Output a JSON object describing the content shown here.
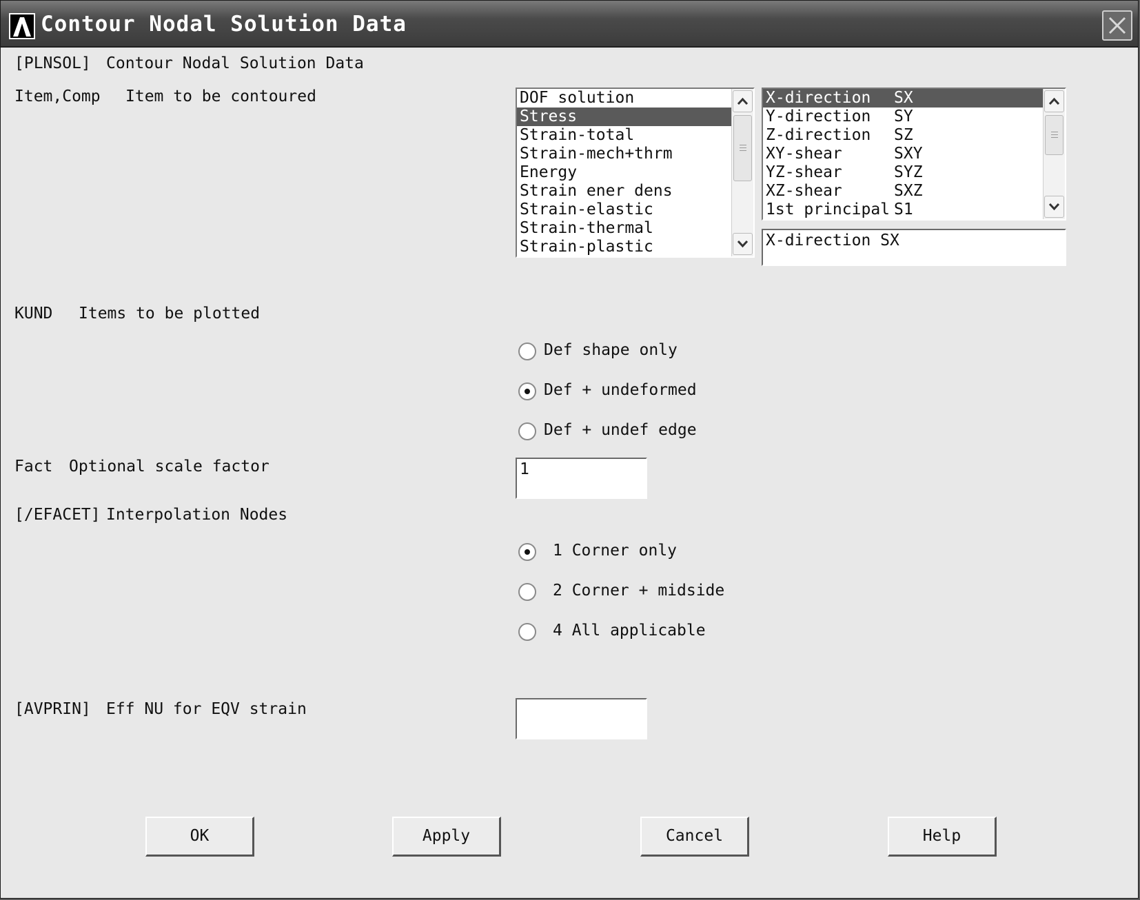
{
  "window": {
    "title": "Contour Nodal Solution Data"
  },
  "header": {
    "cmd": "[PLNSOL]",
    "desc": "Contour Nodal Solution Data"
  },
  "item_comp": {
    "code": "Item,Comp",
    "desc": "Item to be contoured",
    "items": [
      "DOF solution",
      "Stress",
      "Strain-total",
      "Strain-mech+thrm",
      "Energy",
      "Strain ener dens",
      "Strain-elastic",
      "Strain-thermal",
      "Strain-plastic"
    ],
    "selected_item": "Stress",
    "components": [
      {
        "name": "X-direction",
        "code": "SX"
      },
      {
        "name": "Y-direction",
        "code": "SY"
      },
      {
        "name": "Z-direction",
        "code": "SZ"
      },
      {
        "name": "XY-shear",
        "code": "SXY"
      },
      {
        "name": "YZ-shear",
        "code": "SYZ"
      },
      {
        "name": "XZ-shear",
        "code": "SXZ"
      },
      {
        "name": "1st principal",
        "code": "S1"
      }
    ],
    "selected_component": "X-direction",
    "component_value": "X-direction    SX"
  },
  "kund": {
    "code": "KUND",
    "desc": "Items to be plotted",
    "options": [
      "Def shape only",
      "Def + undeformed",
      "Def + undef edge"
    ],
    "selected": "Def + undeformed"
  },
  "fact": {
    "code": "Fact",
    "desc": "Optional scale factor",
    "value": "1"
  },
  "efacet": {
    "code": "[/EFACET]",
    "desc": "Interpolation Nodes",
    "options": [
      "1 Corner only",
      "2 Corner + midside",
      "4 All applicable"
    ],
    "selected": "1 Corner only"
  },
  "avprin": {
    "code": "[AVPRIN]",
    "desc": "Eff NU for EQV strain",
    "value": ""
  },
  "buttons": {
    "ok": "OK",
    "apply": "Apply",
    "cancel": "Cancel",
    "help": "Help"
  }
}
